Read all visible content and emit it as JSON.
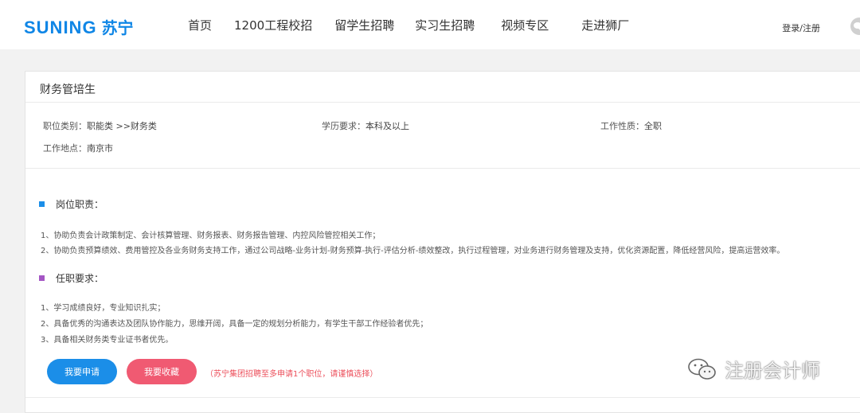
{
  "header": {
    "logo_en": "SUNING",
    "logo_zh": "苏宁",
    "nav": [
      {
        "label": "首页"
      },
      {
        "label": "1200工程校招"
      },
      {
        "label": "留学生招聘"
      },
      {
        "label": "实习生招聘"
      },
      {
        "label": "视频专区"
      },
      {
        "label": "走进狮厂"
      }
    ],
    "login": "登录/注册"
  },
  "job": {
    "title": "财务管培生",
    "category_label": "职位类别：",
    "category_value": "职能类 >>财务类",
    "education_label": "学历要求：",
    "education_value": "本科及以上",
    "nature_label": "工作性质：",
    "nature_value": "全职",
    "location_label": "工作地点：",
    "location_value": "南京市"
  },
  "duties": {
    "heading": "岗位职责：",
    "lines": [
      "1、协助负责会计政策制定、会计核算管理、财务报表、财务报告管理、内控风险管控相关工作；",
      "2、协助负责预算绩效、费用管控及各业务财务支持工作，通过公司战略-业务计划-财务预算-执行-评估分析-绩效整改，执行过程管理，对业务进行财务管理及支持，优化资源配置，降低经营风险，提高运营效率。"
    ]
  },
  "requirements": {
    "heading": "任职要求：",
    "lines": [
      "1、学习成绩良好，专业知识扎实；",
      "2、具备优秀的沟通表达及团队协作能力，思维开阔，具备一定的规划分析能力，有学生干部工作经验者优先；",
      "3、具备相关财务类专业证书者优先。"
    ]
  },
  "actions": {
    "apply": "我要申请",
    "favorite": "我要收藏",
    "notice": "（苏宁集团招聘至多申请1个职位，请谨慎选择）"
  },
  "watermark": {
    "text": "注册会计师"
  },
  "colors": {
    "brand": "#0f86e6",
    "apply": "#1b8ee8",
    "favorite": "#f05a72",
    "notice": "#ec4f5b",
    "duties_marker": "#1b8ee8",
    "requirements_marker": "#a456c4"
  }
}
